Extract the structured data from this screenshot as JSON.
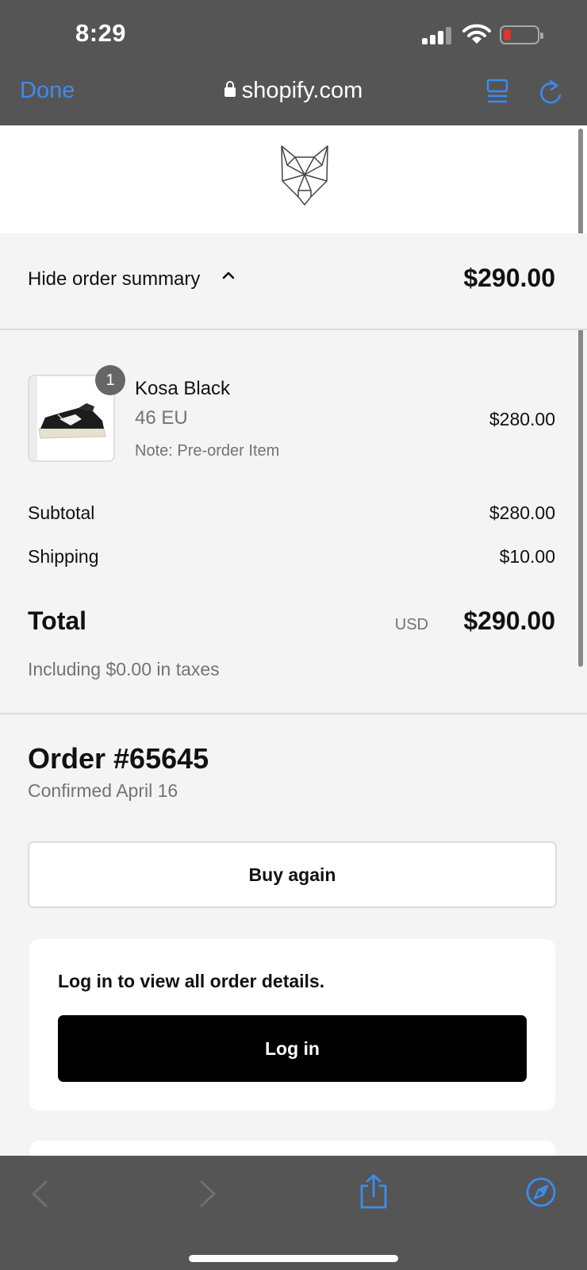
{
  "status_bar": {
    "time": "8:29"
  },
  "browser": {
    "done_label": "Done",
    "url": "shopify.com"
  },
  "summary": {
    "toggle_label": "Hide order summary",
    "total": "$290.00"
  },
  "line_item": {
    "quantity": "1",
    "name": "Kosa Black",
    "variant": "46 EU",
    "note": "Note: Pre-order Item",
    "price": "$280.00"
  },
  "totals": {
    "subtotal_label": "Subtotal",
    "subtotal_value": "$280.00",
    "shipping_label": "Shipping",
    "shipping_value": "$10.00",
    "total_label": "Total",
    "currency": "USD",
    "total_value": "$290.00",
    "taxes_note": "Including $0.00 in taxes"
  },
  "order": {
    "title": "Order #65645",
    "confirmed": "Confirmed April 16",
    "buy_again_label": "Buy again",
    "login_prompt": "Log in to view all order details.",
    "login_label": "Log in"
  },
  "colors": {
    "accent_blue": "#3b8cf2",
    "chrome_gray": "#555555",
    "battery_low": "#e5322b"
  },
  "icons": [
    "lock-icon",
    "reader-mode-icon",
    "reload-icon",
    "wolf-logo",
    "chevron-up-icon",
    "back-arrow-icon",
    "forward-arrow-icon",
    "share-icon",
    "compass-icon"
  ]
}
